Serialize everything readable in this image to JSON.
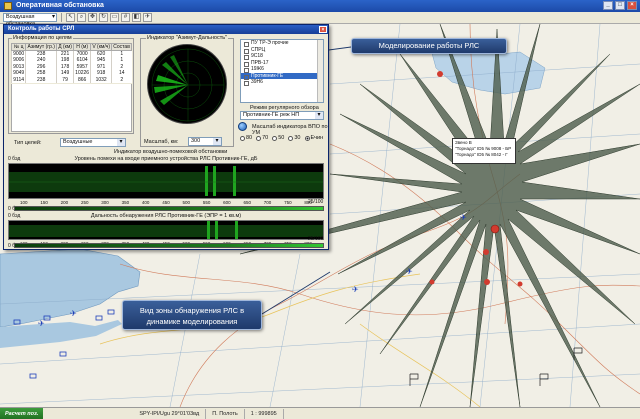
{
  "window": {
    "title": "Оперативная обстановка",
    "controls": [
      "_",
      "□",
      "×"
    ]
  },
  "toolbar": {
    "mode_value": "Воздушная обстановка",
    "tools": [
      "pointer-icon",
      "magnify-icon",
      "pan-icon",
      "rotate-icon",
      "ruler-icon",
      "grid-icon",
      "layers-icon",
      "aircraft-icon"
    ]
  },
  "dialog": {
    "title": "Контроль работы СРЛ",
    "targets_group": "Информация по целям",
    "targets_table": {
      "columns": [
        "№ ц",
        "Азимут (гр.)",
        "Д (км)",
        "Н (м)",
        "V (км/ч)",
        "Состав"
      ],
      "rows": [
        [
          "9000",
          "238",
          "221",
          "7000",
          "620",
          "1"
        ],
        [
          "9006",
          "240",
          "198",
          "6104",
          "945",
          "1"
        ],
        [
          "9013",
          "296",
          "178",
          "5957",
          "971",
          "2"
        ],
        [
          "9049",
          "258",
          "149",
          "10226",
          "918",
          "14"
        ],
        [
          "9114",
          "238",
          "79",
          "866",
          "1032",
          "2"
        ]
      ]
    },
    "target_type_label": "Тип целей:",
    "target_type_value": "Воздушные",
    "indicator_group": "Индикатор \"Азимут-Дальность\"",
    "scale_label": "Масштаб, км:",
    "scale_value": "300",
    "stations": [
      "ПУ ТР-Э прочие",
      "СПРЦ",
      "9С18",
      "ПРВ-17",
      "19Ж6",
      "Противник-ГЕ",
      "39Н6"
    ],
    "station_selected_index": 5,
    "review_mode_label": "Режим регулярного обзора",
    "review_mode_value": "Противник-ГЕ реж НП",
    "scale_selector_label": "Масштаб индикатора ВПО по УМ",
    "scale_options": [
      "80",
      "70",
      "50",
      "30",
      "Ечин"
    ],
    "scale_selected_index": 4,
    "airspace_label": "Индикатор воздушно-помеховой обстановки",
    "plot1": {
      "title": "Уровень помехи на входе приемного устройства РЛС Противник-ГЕ, дБ",
      "left_tag": "0 бэд",
      "bottom_tag": "0 бэд",
      "xticks": [
        "100",
        "150",
        "200",
        "250",
        "300",
        "350",
        "400",
        "450",
        "500",
        "550",
        "600",
        "650",
        "700",
        "750",
        "800"
      ],
      "range_end": "25/100"
    },
    "plot2": {
      "title": "Дальность обнаружения РЛС Противник-ГЕ (ЭПР = 1 кв.м)",
      "left_tag": "0 бэд",
      "bottom_tag": "0 бэд",
      "xticks": [
        "100",
        "150",
        "200",
        "250",
        "300",
        "350",
        "400",
        "450",
        "500",
        "550",
        "600",
        "650",
        "700",
        "750",
        "800"
      ],
      "range_end": "25/100"
    }
  },
  "callouts": {
    "simulation": "Моделирование работы РЛС",
    "zone_line1": "Вид зоны обнаружения РЛС в",
    "zone_line2": "динамике моделирования"
  },
  "info_box": {
    "line1": "Звено В",
    "line2": "\"Торнадо\" ID5 № 9008 - БР",
    "line3": "\"Торнадо\" ID5 № 8042 - Г"
  },
  "status": {
    "start": "Расчет поз.",
    "cells": [
      "SPY-IPI/Ugu 29°01'03вд",
      "П. Полоть",
      "1 : 999895"
    ]
  },
  "colors": {
    "map_water": "#a9c8e0",
    "map_land": "#f1efe6",
    "radar_zone": "#5d6b5c",
    "scope_green": "#19b519",
    "threat_red": "#d23b2f",
    "friendly_blue": "#1d3fb8"
  }
}
